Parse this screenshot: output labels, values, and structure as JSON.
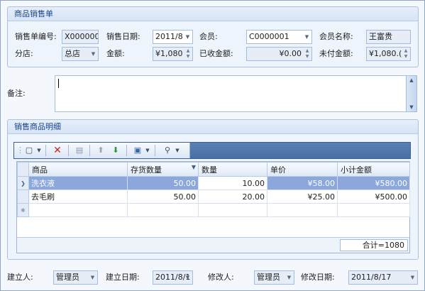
{
  "header_group": {
    "title": "商品销售单",
    "order_no_label": "销售单编号:",
    "order_no_value": "X000000",
    "sale_date_label": "销售日期:",
    "sale_date_value": "2011/8",
    "member_label": "会员:",
    "member_value": "C0000001",
    "member_name_label": "会员名称:",
    "member_name_value": "王富贵",
    "branch_label": "分店:",
    "branch_value": "总店",
    "amount_label": "金额:",
    "amount_value": "¥1,080",
    "received_label": "已收金额:",
    "received_value": "¥0.00",
    "unpaid_label": "未付金额:",
    "unpaid_value": "¥1,080.("
  },
  "remarks": {
    "label": "备注:",
    "value": ""
  },
  "detail_group": {
    "title": "销售商品明细",
    "columns": [
      "商品",
      "存货数量",
      "数量",
      "单价",
      "小计金额"
    ],
    "rows": [
      {
        "product": "洗衣液",
        "stock": "50.00",
        "qty": "10.00",
        "price": "¥58.00",
        "subtotal": "¥580.00"
      },
      {
        "product": "去毛刷",
        "stock": "50.00",
        "qty": "20.00",
        "price": "¥25.00",
        "subtotal": "¥500.00"
      }
    ],
    "total": "合计=1080"
  },
  "bottom_bar": {
    "creator_label": "建立人:",
    "creator_value": "管理员",
    "created_date_label": "建立日期:",
    "created_date_value": "2011/8/1",
    "modifier_label": "修改人:",
    "modifier_value": "管理员",
    "modified_date_label": "修改日期:",
    "modified_date_value": "2011/8/17"
  },
  "colors": {
    "accent": "#15428b",
    "selected_row": "#8ca7dc",
    "toolbar": "#4a6fa5"
  }
}
